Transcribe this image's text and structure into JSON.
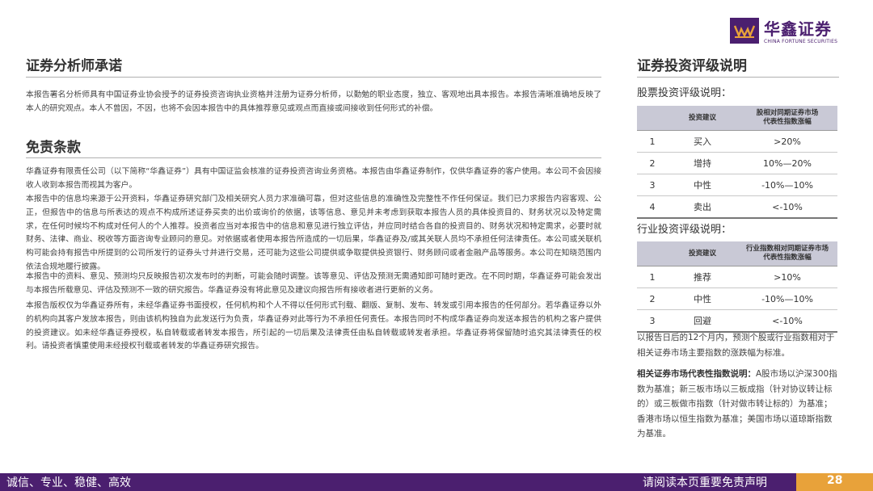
{
  "header": {
    "logo_cn": "华鑫证券",
    "logo_en": "CHINA FORTUNE SECURITIES"
  },
  "analyst": {
    "title": "证券分析师承诺",
    "text": "本报告署名分析师具有中国证券业协会授予的证券投资咨询执业资格并注册为证券分析师，以勤勉的职业态度，独立、客观地出具本报告。本报告清晰准确地反映了本人的研究观点。本人不曾因，不因，也将不会因本报告中的具体推荐意见或观点而直接或间接收到任何形式的补偿。"
  },
  "disclaimer": {
    "title": "免责条款",
    "paragraphs": [
      "华鑫证券有限责任公司（以下简称“华鑫证券”）具有中国证监会核准的证券投资咨询业务资格。本报告由华鑫证券制作，仅供华鑫证券的客户使用。本公司不会因接收人收到本报告而视其为客户。",
      "本报告中的信息均来源于公开资料，华鑫证券研究部门及相关研究人员力求准确可靠，但对这些信息的准确性及完整性不作任何保证。我们已力求报告内容客观、公正，但报告中的信息与所表达的观点不构成所述证券买卖的出价或询价的依据，该等信息、意见并未考虑到获取本报告人员的具体投资目的、财务状况以及特定需求，在任何时候均不构成对任何人的个人推荐。投资者应当对本报告中的信息和意见进行独立评估，并应同时结合各自的投资目的、财务状况和特定需求，必要时就财务、法律、商业、税收等方面咨询专业顾问的意见。对依据或者使用本报告所造成的一切后果，华鑫证券及/或其关联人员均不承担任何法律责任。本公司或关联机构可能会持有报告中所提到的公司所发行的证券头寸并进行交易，还可能为这些公司提供或争取提供投资银行、财务顾问或者金融产品等服务。本公司在知晓范围内依法合规地履行披露。",
      "本报告中的资料、意见、预测均只反映报告初次发布时的判断，可能会随时调整。该等意见、评估及预测无需通知即可随时更改。在不同时期，华鑫证券可能会发出与本报告所载意见、评估及预测不一致的研究报告。华鑫证券没有将此意见及建议向报告所有接收者进行更新的义务。",
      "本报告版权仅为华鑫证券所有，未经华鑫证券书面授权，任何机构和个人不得以任何形式刊载、翻版、复制、发布、转发或引用本报告的任何部分。若华鑫证券以外的机构向其客户发放本报告，则由该机构独自为此发送行为负责，华鑫证券对此等行为不承担任何责任。本报告同时不构成华鑫证券向发送本报告的机构之客户提供的投资建议。如未经华鑫证券授权，私自转载或者转发本报告，所引起的一切后果及法律责任由私自转载或转发者承担。华鑫证券将保留随时追究其法律责任的权利。请投资者慎重使用未经授权刊载或者转发的华鑫证券研究报告。"
    ]
  },
  "rating": {
    "title": "证券投资评级说明",
    "stock_label": "股票投资评级说明：",
    "stock_headers": [
      "",
      "投资建议",
      "股相对同期证券市场\n代表性指数涨幅"
    ],
    "stock_rows": [
      [
        "1",
        "买入",
        ">20%"
      ],
      [
        "2",
        "增持",
        "10%—20%"
      ],
      [
        "3",
        "中性",
        "-10%—10%"
      ],
      [
        "4",
        "卖出",
        "<-10%"
      ]
    ],
    "industry_label": "行业投资评级说明：",
    "industry_headers": [
      "",
      "投资建议",
      "行业指数相对同期证券市场\n代表性指数涨幅"
    ],
    "industry_rows": [
      [
        "1",
        "推荐",
        ">10%"
      ],
      [
        "2",
        "中性",
        "-10%—10%"
      ],
      [
        "3",
        "回避",
        "<-10%"
      ]
    ],
    "period_note": "以报告日后的12个月内，预测个股或行业指数相对于相关证券市场主要指数的涨跌幅为标准。",
    "index_note_label": "相关证券市场代表性指数说明：",
    "index_note_text": "A股市场以沪深300指数为基准；新三板市场以三板成指（针对协议转让标的）或三板做市指数（针对做市转让标的）为基准；香港市场以恒生指数为基准；美国市场以道琼斯指数为基准。"
  },
  "footer": {
    "slogan": "诚信、专业、稳健、高效",
    "notice": "请阅读本页重要免责声明",
    "page": "28"
  },
  "colors": {
    "brand_purple": "#4b1f6f",
    "accent_orange": "#e8a23a",
    "table_header": "#c9c9d6"
  }
}
